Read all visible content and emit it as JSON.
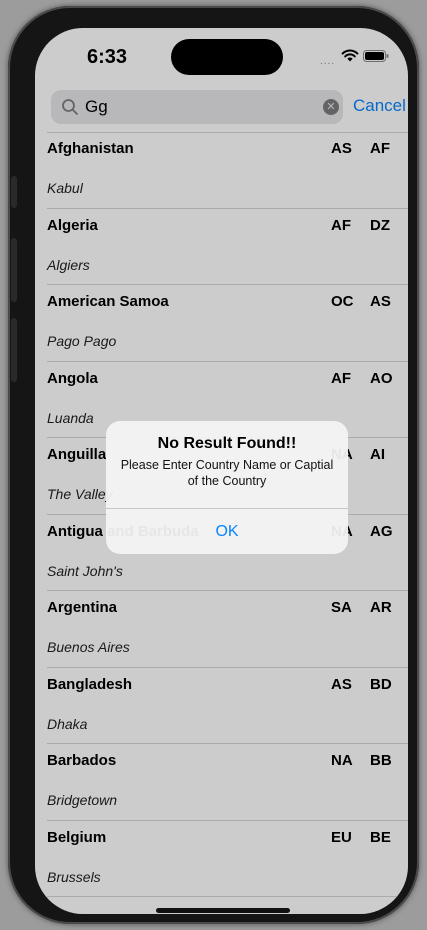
{
  "status_bar": {
    "time": "6:33",
    "signal": "....",
    "wifi_icon": "wifi-icon",
    "battery_icon": "battery-icon"
  },
  "search": {
    "value": "Gg",
    "icon": "search-icon",
    "clear_icon": "clear-icon",
    "cancel_label": "Cancel"
  },
  "countries": [
    {
      "name": "Afghanistan",
      "continent": "AS",
      "code": "AF",
      "capital": "Kabul"
    },
    {
      "name": "Algeria",
      "continent": "AF",
      "code": "DZ",
      "capital": "Algiers"
    },
    {
      "name": "American Samoa",
      "continent": "OC",
      "code": "AS",
      "capital": "Pago Pago"
    },
    {
      "name": "Angola",
      "continent": "AF",
      "code": "AO",
      "capital": "Luanda"
    },
    {
      "name": "Anguilla",
      "continent": "NA",
      "code": "AI",
      "capital": "The Valley"
    },
    {
      "name": "Antigua and Barbuda",
      "continent": "NA",
      "code": "AG",
      "capital": "Saint John's"
    },
    {
      "name": "Argentina",
      "continent": "SA",
      "code": "AR",
      "capital": "Buenos Aires"
    },
    {
      "name": "Bangladesh",
      "continent": "AS",
      "code": "BD",
      "capital": "Dhaka"
    },
    {
      "name": "Barbados",
      "continent": "NA",
      "code": "BB",
      "capital": "Bridgetown"
    },
    {
      "name": "Belgium",
      "continent": "EU",
      "code": "BE",
      "capital": "Brussels"
    }
  ],
  "alert": {
    "title": "No Result Found!!",
    "message": "Please Enter Country Name or Captial of the Country",
    "ok_label": "OK"
  },
  "colors": {
    "accent": "#0a84ff",
    "overlay": "rgba(0,0,0,0.2)"
  }
}
